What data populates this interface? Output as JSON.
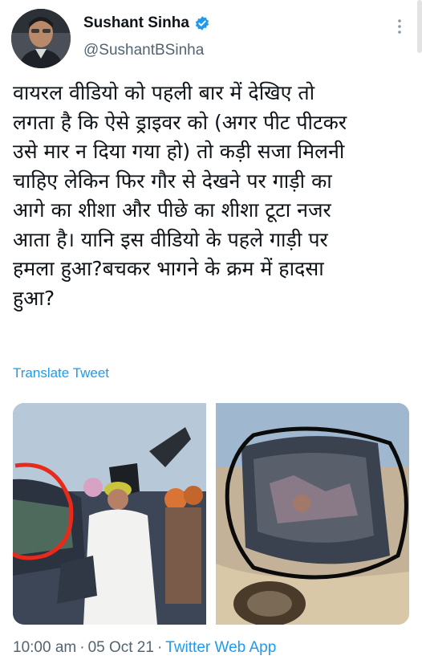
{
  "author": {
    "name": "Sushant Sinha",
    "handle": "@SushantBSinha"
  },
  "tweet": {
    "text": "वायरल वीडियो को पहली बार में देखिए तो\nलगता है कि ऐसे ड्राइवर को (अगर पीट पीटकर\nउसे मार न दिया गया हो) तो कड़ी सजा मिलनी\nचाहिए लेकिन फिर गौर से देखने पर गाड़ी का\nआगे का शीशा और पीछे का शीशा टूटा नजर\nआता है। यानि इस वीडियो के पहले गाड़ी पर\nहमला हुआ?बचकर भागने के क्रम में हादसा\nहुआ?",
    "translate_label": "Translate Tweet"
  },
  "meta": {
    "time": "10:00 am",
    "separator": "·",
    "date": "05 Oct 21",
    "separator2": "·",
    "source": "Twitter Web App"
  },
  "colors": {
    "link": "#1d9bf0",
    "verified": "#1d9bf0",
    "secondary_text": "#536471"
  }
}
